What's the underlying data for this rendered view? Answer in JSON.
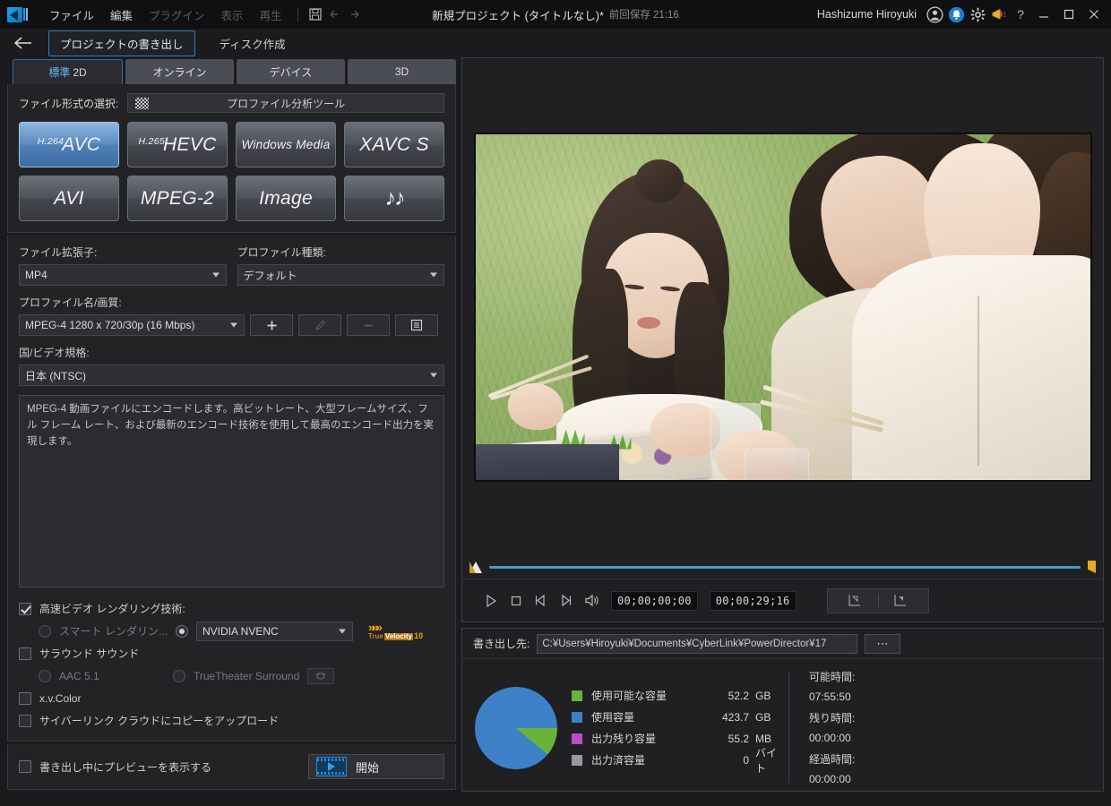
{
  "titlebar": {
    "logo_icon": "powerdirector-logo-icon",
    "menus": [
      {
        "label": "ファイル",
        "enabled": true
      },
      {
        "label": "編集",
        "enabled": true
      },
      {
        "label": "プラグイン",
        "enabled": false
      },
      {
        "label": "表示",
        "enabled": false
      },
      {
        "label": "再生",
        "enabled": false
      }
    ],
    "save_icon": "save-icon",
    "undo_icon": "undo-icon",
    "redo_icon": "redo-icon",
    "project_name": "新規プロジェクト (タイトルなし)*",
    "last_saved": "前回保存 21:16",
    "user_name": "Hashizume Hiroyuki",
    "account_icon": "account-icon",
    "notification_icon": "bell-icon",
    "settings_icon": "gear-icon",
    "announcement_icon": "megaphone-icon",
    "help_icon": "help-icon",
    "minimize_icon": "minimize-icon",
    "maximize_icon": "maximize-icon",
    "close_icon": "close-icon"
  },
  "navbar": {
    "back_icon": "back-arrow-icon",
    "produce_tab": "プロジェクトの書き出し",
    "disc_tab": "ディスク作成"
  },
  "left_panel": {
    "tabs": [
      {
        "label": "標準",
        "sub": "2D",
        "active": true
      },
      {
        "label": "オンライン",
        "sub": "",
        "active": false
      },
      {
        "label": "デバイス",
        "sub": "",
        "active": false
      },
      {
        "label": "3D",
        "sub": "",
        "active": false
      }
    ],
    "format_section_label": "ファイル形式の選択:",
    "profile_analysis_button": "プロファイル分析ツール",
    "profile_analysis_icon": "checker-pattern-icon",
    "formats": [
      {
        "sup": "H.264",
        "main": "AVC",
        "selected": true,
        "size": "large"
      },
      {
        "sup": "H.265",
        "main": "HEVC",
        "selected": false,
        "size": "large"
      },
      {
        "sup": "",
        "main": "Windows Media",
        "selected": false,
        "size": "small"
      },
      {
        "sup": "",
        "main": "XAVC S",
        "selected": false,
        "size": "large"
      },
      {
        "sup": "",
        "main": "AVI",
        "selected": false,
        "size": "large"
      },
      {
        "sup": "",
        "main": "MPEG-2",
        "selected": false,
        "size": "large"
      },
      {
        "sup": "",
        "main": "Image",
        "selected": false,
        "size": "large"
      },
      {
        "sup": "",
        "main": "♪♪",
        "selected": false,
        "size": "music"
      }
    ],
    "file_ext_label": "ファイル拡張子:",
    "file_ext_value": "MP4",
    "profile_type_label": "プロファイル種類:",
    "profile_type_value": "デフォルト",
    "profile_quality_label": "プロファイル名/画質:",
    "profile_quality_value": "MPEG-4 1280 x 720/30p (16 Mbps)",
    "add_button_icon": "plus-icon",
    "edit_button_icon": "pencil-icon",
    "remove_button_icon": "minus-icon",
    "list_button_icon": "list-icon",
    "country_label": "国/ビデオ規格:",
    "country_value": "日本 (NTSC)",
    "description": "MPEG-4 動画ファイルにエンコードします。高ビットレート、大型フレームサイズ、フル フレーム レート、および最新のエンコード技術を使用して最高のエンコード出力を実現します。",
    "options": {
      "fast_render_label": "高速ビデオ レンダリング技術:",
      "fast_render_checked": true,
      "smart_render_label": "スマート レンダリン...",
      "smart_render_selected": false,
      "hw_encoder_selected": true,
      "hw_encoder_value": "NVIDIA NVENC",
      "truevelocity_chevrons": "»»»",
      "truevelocity_true": "True",
      "truevelocity_velocity": "Velocity",
      "truevelocity_version": "10",
      "surround_label": "サラウンド サウンド",
      "surround_checked": false,
      "aac_label": "AAC 5.1",
      "aac_selected": false,
      "truetheater_label": "TrueTheater Surround",
      "truetheater_selected": false,
      "truetheater_icon": "sound-icon",
      "xvcolor_label": "x.v.Color",
      "xvcolor_checked": false,
      "cloud_label": "サイバーリンク クラウドにコピーをアップロード",
      "cloud_checked": false
    },
    "preview_while_export_label": "書き出し中にプレビューを表示する",
    "preview_while_export_checked": false,
    "start_button_label": "開始",
    "start_button_icon": "film-play-icon"
  },
  "preview": {
    "scrub_left_icon": "playhead-marker-icon",
    "scrub_right_icon": "end-marker-icon",
    "controls": [
      {
        "icon": "play-icon",
        "name": "play-button"
      },
      {
        "icon": "stop-icon",
        "name": "stop-button"
      },
      {
        "icon": "prev-frame-icon",
        "name": "previous-frame-button"
      },
      {
        "icon": "next-frame-icon",
        "name": "next-frame-button"
      },
      {
        "icon": "volume-icon",
        "name": "volume-button"
      }
    ],
    "current_timecode": "00;00;00;00",
    "total_timecode": "00;00;29;16",
    "capture_in_icon": "mark-in-icon",
    "capture_out_icon": "mark-out-icon"
  },
  "output": {
    "dest_label": "書き出し先:",
    "dest_path": "C:¥Users¥Hiroyuki¥Documents¥CyberLink¥PowerDirector¥17",
    "browse_button": "⋯",
    "times": [
      {
        "label": "可能時間:",
        "value": "07:55:50"
      },
      {
        "label": "残り時間:",
        "value": "00:00:00"
      },
      {
        "label": "経過時間:",
        "value": "00:00:00"
      }
    ]
  },
  "chart_data": {
    "type": "pie",
    "title": "",
    "categories": [
      "使用可能な容量",
      "使用容量",
      "出力残り容量",
      "出力済容量"
    ],
    "values": [
      52.2,
      423.7,
      55.2,
      0.0
    ],
    "units": [
      "GB",
      "GB",
      "MB",
      "バイト"
    ],
    "colors": [
      "#6ab33a",
      "#3d82c8",
      "#b84fc0",
      "#9a9a9e"
    ],
    "legend_position": "right",
    "slices": [
      {
        "label": "使用可能な容量",
        "value": 52.2,
        "unit": "GB",
        "color": "#6ab33a",
        "percent": 11
      },
      {
        "label": "使用容量",
        "value": 423.7,
        "unit": "GB",
        "color": "#3d82c8",
        "percent": 89
      },
      {
        "label": "出力残り容量",
        "value": 55.2,
        "unit": "MB",
        "color": "#b84fc0",
        "percent": 0
      },
      {
        "label": "出力済容量",
        "value": 0.0,
        "unit": "バイト",
        "color": "#9a9a9e",
        "percent": 0
      }
    ]
  }
}
